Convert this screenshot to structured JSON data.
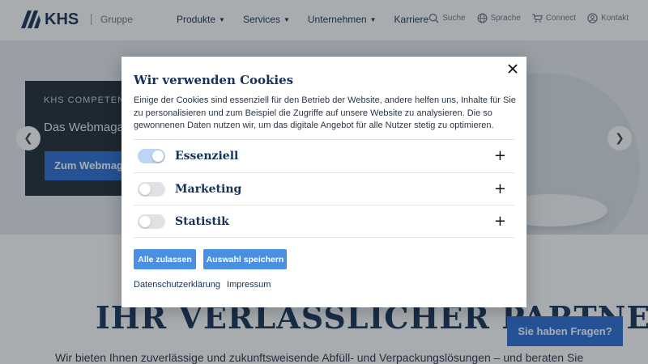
{
  "header": {
    "brand": "KHS",
    "group_label": "Gruppe",
    "nav": [
      {
        "label": "Produkte",
        "has_dropdown": true
      },
      {
        "label": "Services",
        "has_dropdown": true
      },
      {
        "label": "Unternehmen",
        "has_dropdown": true
      },
      {
        "label": "Karriere",
        "has_dropdown": false
      }
    ],
    "utilities": [
      {
        "label": "Suche",
        "icon": "search-icon"
      },
      {
        "label": "Sprache",
        "icon": "globe-icon"
      },
      {
        "label": "Connect",
        "icon": "cart-icon"
      },
      {
        "label": "Kontakt",
        "icon": "user-icon"
      }
    ]
  },
  "hero": {
    "eyebrow": "KHS COMPETENC",
    "title": "Das Webmagaz",
    "button_label": "Zum Webmaga",
    "prev_icon": "chevron-left-icon",
    "next_icon": "chevron-right-icon"
  },
  "page": {
    "tagline": "IHR VERLÄSSLICHER PARTNER",
    "intro": "Wir bieten Ihnen zuverlässige und zukunftsweisende Abfüll- und Verpackungslösungen – und beraten Sie",
    "help_button": "Sie haben Fragen?"
  },
  "cookie_modal": {
    "title": "Wir verwenden Cookies",
    "description": "Einige der Cookies sind essenziell für den Betrieb der Website, andere helfen uns, Inhalte für Sie zu personalisieren und zum Beispiel die Zugriffe auf unsere Website zu analysieren. Die so gewonnenen Daten nutzen wir, um das digitale Angebot für alle Nutzer stetig zu optimieren.",
    "close_icon": "close-icon",
    "categories": [
      {
        "label": "Essenziell",
        "enabled": true
      },
      {
        "label": "Marketing",
        "enabled": false
      },
      {
        "label": "Statistik",
        "enabled": false
      }
    ],
    "expand_icon": "plus-icon",
    "buttons": {
      "accept_all": "Alle zulassen",
      "save_selection": "Auswahl speichern"
    },
    "links": {
      "privacy": "Datenschutzerklärung",
      "imprint": "Impressum"
    }
  },
  "colors": {
    "brand_navy": "#14325a",
    "primary_blue": "#2a6fd6",
    "modal_button": "#4a90e2",
    "toggle_on": "#bcd4f5"
  }
}
